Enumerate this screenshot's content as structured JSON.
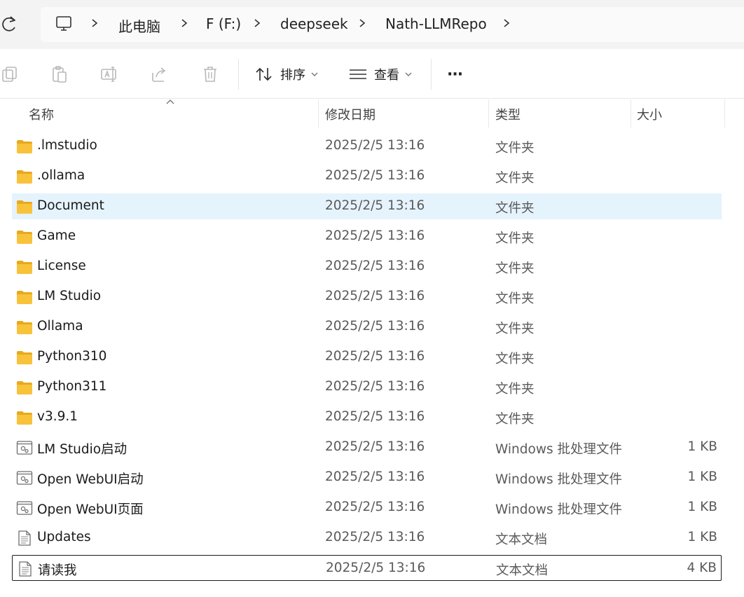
{
  "breadcrumb": [
    "此电脑",
    "F (F:)",
    "deepseek",
    "Nath-LLMRepo"
  ],
  "toolbar": {
    "sort_label": "排序",
    "view_label": "查看",
    "more_label": "···"
  },
  "columns": {
    "name": "名称",
    "modified": "修改日期",
    "type": "类型",
    "size": "大小"
  },
  "files": [
    {
      "name": ".lmstudio",
      "modified": "2025/2/5 13:16",
      "type": "文件夹",
      "size": "",
      "icon": "folder-icon"
    },
    {
      "name": ".ollama",
      "modified": "2025/2/5 13:16",
      "type": "文件夹",
      "size": "",
      "icon": "folder-icon"
    },
    {
      "name": "Document",
      "modified": "2025/2/5 13:16",
      "type": "文件夹",
      "size": "",
      "icon": "folder-icon",
      "state": "hover"
    },
    {
      "name": "Game",
      "modified": "2025/2/5 13:16",
      "type": "文件夹",
      "size": "",
      "icon": "folder-icon"
    },
    {
      "name": "License",
      "modified": "2025/2/5 13:16",
      "type": "文件夹",
      "size": "",
      "icon": "folder-icon"
    },
    {
      "name": "LM Studio",
      "modified": "2025/2/5 13:16",
      "type": "文件夹",
      "size": "",
      "icon": "folder-icon"
    },
    {
      "name": "Ollama",
      "modified": "2025/2/5 13:16",
      "type": "文件夹",
      "size": "",
      "icon": "folder-icon"
    },
    {
      "name": "Python310",
      "modified": "2025/2/5 13:16",
      "type": "文件夹",
      "size": "",
      "icon": "folder-icon"
    },
    {
      "name": "Python311",
      "modified": "2025/2/5 13:16",
      "type": "文件夹",
      "size": "",
      "icon": "folder-icon"
    },
    {
      "name": "v3.9.1",
      "modified": "2025/2/5 13:16",
      "type": "文件夹",
      "size": "",
      "icon": "folder-icon"
    },
    {
      "name": "LM Studio启动",
      "modified": "2025/2/5 13:16",
      "type": "Windows 批处理文件",
      "size": "1 KB",
      "icon": "batch-file-icon"
    },
    {
      "name": "Open WebUI启动",
      "modified": "2025/2/5 13:16",
      "type": "Windows 批处理文件",
      "size": "1 KB",
      "icon": "batch-file-icon"
    },
    {
      "name": "Open WebUI页面",
      "modified": "2025/2/5 13:16",
      "type": "Windows 批处理文件",
      "size": "1 KB",
      "icon": "batch-file-icon"
    },
    {
      "name": "Updates",
      "modified": "2025/2/5 13:16",
      "type": "文本文档",
      "size": "1 KB",
      "icon": "text-file-icon"
    },
    {
      "name": "请读我",
      "modified": "2025/2/5 13:16",
      "type": "文本文档",
      "size": "4 KB",
      "icon": "text-file-icon",
      "state": "focused"
    }
  ],
  "colors": {
    "hover": "#e5f3fd",
    "folder": "#f8c33a",
    "addressbar": "#f3f3f3"
  }
}
